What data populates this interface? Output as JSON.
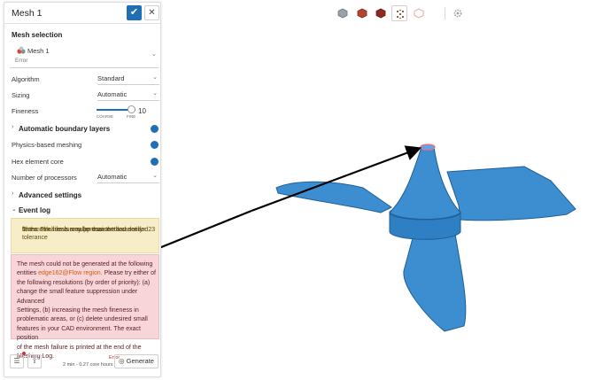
{
  "panel": {
    "title": "Mesh 1",
    "mesh_selection_heading": "Mesh selection",
    "mesh_item": {
      "name": "Mesh 1",
      "status": "Error"
    },
    "algorithm": {
      "label": "Algorithm",
      "value": "Standard"
    },
    "sizing": {
      "label": "Sizing",
      "value": "Automatic"
    },
    "fineness": {
      "label": "Fineness",
      "min_label": "COARSE",
      "max_label": "FINE",
      "value": "10"
    },
    "boundary_layers": {
      "label": "Automatic boundary layers",
      "enabled": true
    },
    "physics_meshing": {
      "label": "Physics-based meshing",
      "enabled": true
    },
    "hex_core": {
      "label": "Hex element core",
      "enabled": true
    },
    "processors": {
      "label": "Number of processors",
      "value": "Automatic"
    },
    "advanced_settings": "Advanced settings",
    "event_log": {
      "heading": "Event log",
      "warning_lines": [
        "The mesh size is smaller than the cad entity tolerance",
        "or the small feature suppression tolerance for 23",
        "faces. The mesh may be coarser than desired."
      ],
      "error_lines": [
        "The mesh could not be generated at the following",
        "entities ",
        " Please try either of",
        "the following resolutions (by order of priority): (a)",
        "change the small feature suppression under Advanced",
        "Settings, (b) increasing the mesh fineness in",
        "problematic areas, or (c) delete undesired small",
        "features in your CAD environment. The exact position",
        "of the mesh failure is printed at the end of the",
        "Meshing Log."
      ],
      "error_entity": "edge162@Flow region."
    },
    "footer": {
      "status": "Error",
      "time": "2 min - 0.27 core hours",
      "generate_label": "Generate"
    }
  },
  "toolbar": {
    "icons": [
      "box-icon",
      "cube-red-icon",
      "cube-dark-red-icon",
      "dots-cube-icon",
      "hex-outline-icon",
      "gear-icon"
    ],
    "active_index": 3
  },
  "colors": {
    "accent": "#1f6fb5",
    "model": "#3c8ed1",
    "model_shadow": "#2a6ea8",
    "warning_bg": "#f7edc8",
    "error_bg": "#f7d5d8",
    "error_entity": "#d45d14",
    "arrow": "#000000"
  }
}
